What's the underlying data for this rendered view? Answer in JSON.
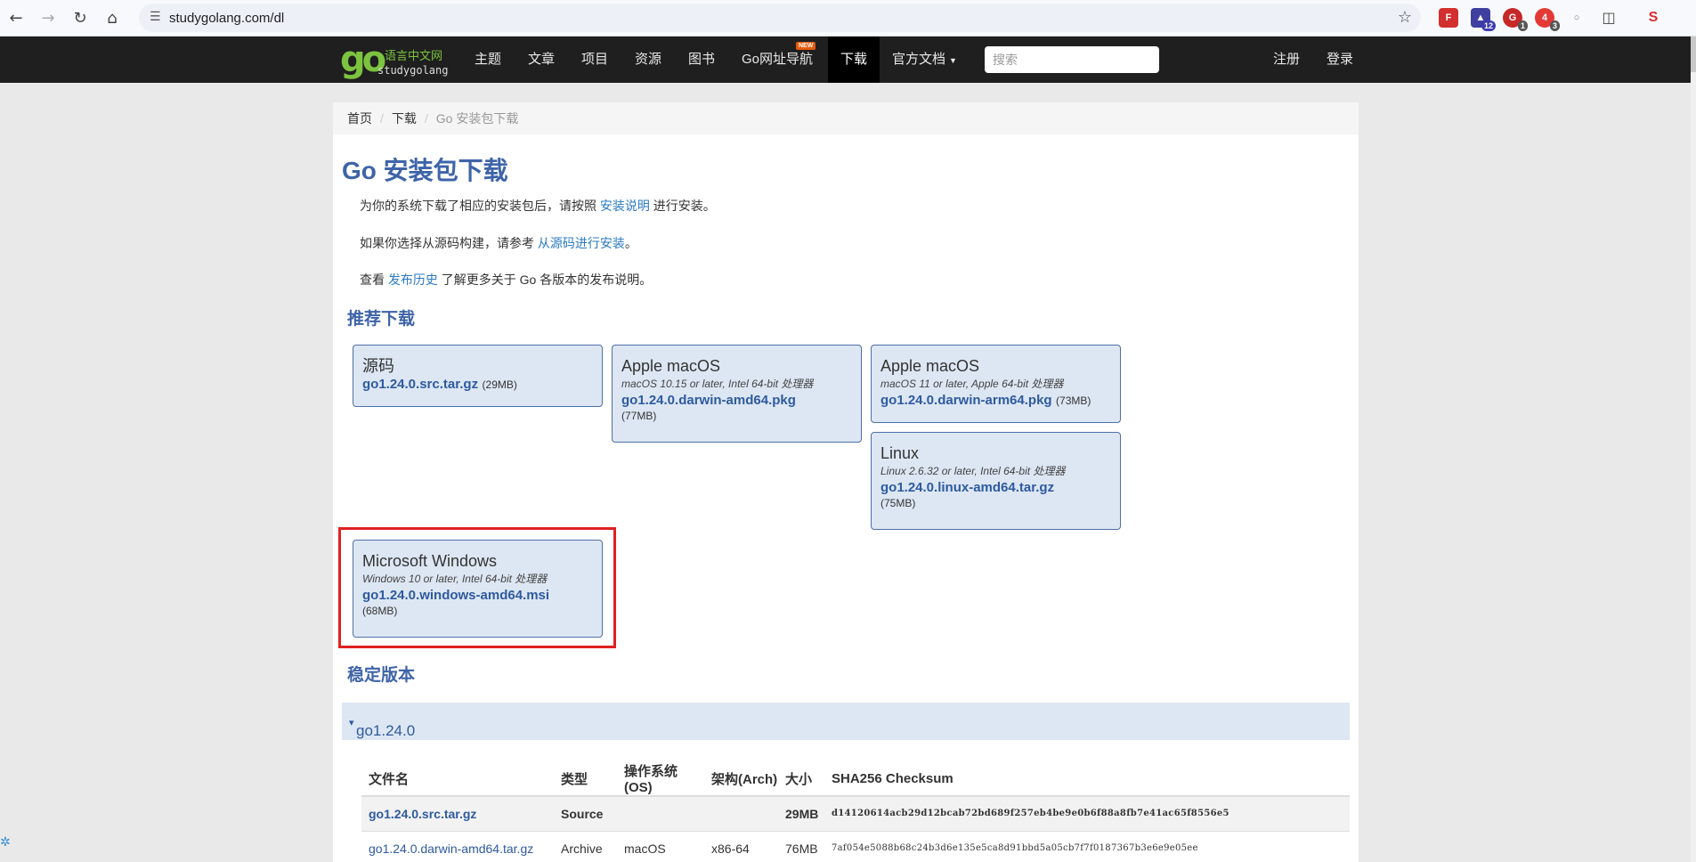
{
  "browser": {
    "url": "studygolang.com/dl"
  },
  "navbar": {
    "logo_cn": "语言中文网",
    "logo_en": "studygolang",
    "items": [
      "主题",
      "文章",
      "项目",
      "资源",
      "图书",
      "Go网址导航",
      "下载",
      "官方文档"
    ],
    "new_badge": "NEW",
    "search_placeholder": "搜索",
    "register": "注册",
    "login": "登录"
  },
  "breadcrumb": {
    "home": "首页",
    "download": "下载",
    "current": "Go 安装包下载"
  },
  "page": {
    "title": "Go 安装包下载",
    "p1_before": "为你的系统下载了相应的安装包后，请按照 ",
    "p1_link": "安装说明",
    "p1_after": " 进行安装。",
    "p2_before": "如果你选择从源码构建，请参考 ",
    "p2_link": "从源码进行安装",
    "p2_after": "。",
    "p3_before": "查看 ",
    "p3_link": "发布历史",
    "p3_after": " 了解更多关于 Go 各版本的发布说明。",
    "recommended_heading": "推荐下载",
    "stable_heading": "稳定版本"
  },
  "featured": [
    {
      "title": "源码",
      "sub": "",
      "file": "go1.24.0.src.tar.gz",
      "size": "(29MB)"
    },
    {
      "title": "Apple macOS",
      "sub": "macOS 10.15 or later, Intel 64-bit 处理器",
      "file": "go1.24.0.darwin-amd64.pkg",
      "size": "(77MB)"
    },
    {
      "title": "Apple macOS",
      "sub": "macOS 11 or later, Apple 64-bit 处理器",
      "file": "go1.24.0.darwin-arm64.pkg",
      "size": "(73MB)"
    },
    {
      "title": "Linux",
      "sub": "Linux 2.6.32 or later, Intel 64-bit 处理器",
      "file": "go1.24.0.linux-amd64.tar.gz",
      "size": "(75MB)"
    },
    {
      "title": "Microsoft Windows",
      "sub": "Windows 10 or later, Intel 64-bit 处理器",
      "file": "go1.24.0.windows-amd64.msi",
      "size": "(68MB)"
    }
  ],
  "stable": {
    "version": "go1.24.0",
    "caret": "▾",
    "headers": [
      "文件名",
      "类型",
      "操作系统(OS)",
      "架构(Arch)",
      "大小",
      "SHA256 Checksum"
    ],
    "rows": [
      [
        "go1.24.0.src.tar.gz",
        "Source",
        "",
        "",
        "29MB",
        "d14120614acb29d12bcab72bd689f257eb4be9e0b6f88a8fb7e41ac65f8556e5"
      ],
      [
        "go1.24.0.darwin-amd64.tar.gz",
        "Archive",
        "macOS",
        "x86-64",
        "76MB",
        "7af054e5088b68c24b3d6e135e5ca8d91bbd5a05cb7f7f0187367b3e6e9e05ee"
      ]
    ]
  },
  "colors": {
    "accent": "#3e64a8",
    "card_bg": "#dde7f3",
    "highlight": "#e02020",
    "logo_green": "#7cc33f"
  }
}
